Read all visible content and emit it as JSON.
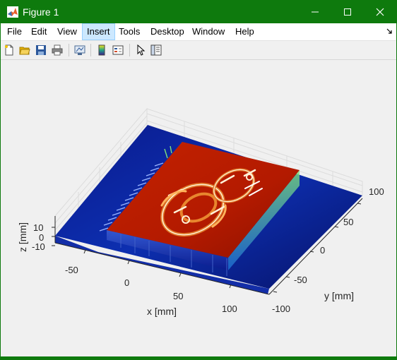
{
  "window": {
    "title": "Figure 1"
  },
  "menu": [
    "File",
    "Edit",
    "View",
    "Insert",
    "Tools",
    "Desktop",
    "Window",
    "Help"
  ],
  "toolbar_icons": [
    "new-figure-icon",
    "open-file-icon",
    "save-icon",
    "print-icon",
    "link-plot-icon",
    "insert-colorbar-icon",
    "insert-legend-icon",
    "edit-plot-icon",
    "property-inspector-icon"
  ],
  "colors": {
    "titlebar": "#0e7a0d",
    "menu_active": "#cce8ff",
    "surface_high": "#b31a00",
    "surface_low": "#0a1a8c"
  },
  "chart_data": {
    "type": "surface",
    "xlabel": "x [mm]",
    "ylabel": "y [mm]",
    "zlabel": "z [mm]",
    "x_ticks": [
      "-50",
      "0",
      "50",
      "100"
    ],
    "y_ticks": [
      "100",
      "50",
      "0",
      "-50",
      "-100"
    ],
    "z_ticks": [
      "10",
      "0",
      "-10"
    ],
    "grid": true
  }
}
